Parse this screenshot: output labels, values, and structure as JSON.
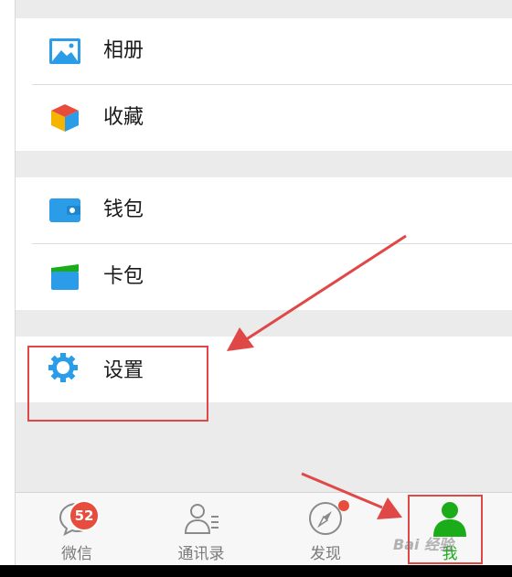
{
  "menu": {
    "album_label": "相册",
    "favorites_label": "收藏",
    "wallet_label": "钱包",
    "cards_label": "卡包",
    "settings_label": "设置"
  },
  "tabbar": {
    "tabs": [
      {
        "label": "微信",
        "icon": "chat-icon",
        "badge": "52"
      },
      {
        "label": "通讯录",
        "icon": "contacts-icon"
      },
      {
        "label": "发现",
        "icon": "compass-icon"
      },
      {
        "label": "我",
        "icon": "person-icon",
        "active": true
      }
    ]
  },
  "watermark_text": "Bai 经验",
  "colors": {
    "accent_green": "#1aad19",
    "badge_red": "#e74c3c",
    "icon_blue": "#2a9ce8",
    "annotation_red": "#e04848"
  }
}
